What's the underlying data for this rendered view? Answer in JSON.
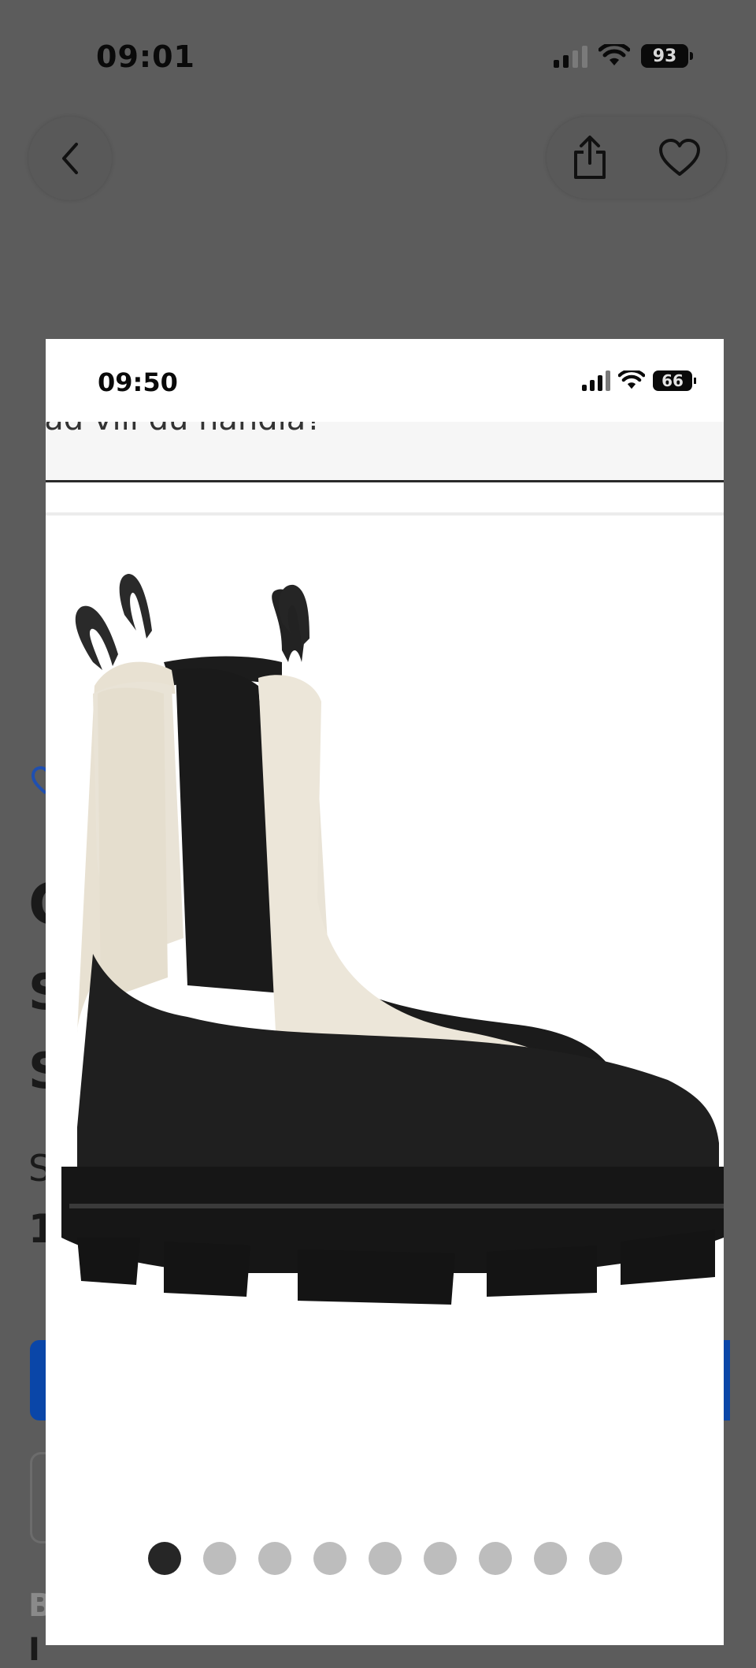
{
  "outer_status": {
    "time": "09:01",
    "battery": "93"
  },
  "inner_status": {
    "time": "09:50",
    "battery": "66"
  },
  "search": {
    "partial_text": "Vad vill du handla?"
  },
  "carousel": {
    "image_count": 9,
    "active_index": 0
  },
  "icons": {
    "back": "chevron-left-icon",
    "share": "share-icon",
    "favorite": "heart-icon"
  },
  "colors": {
    "overlay": "#5c5c5c",
    "accent_blue": "#0a46a8"
  }
}
